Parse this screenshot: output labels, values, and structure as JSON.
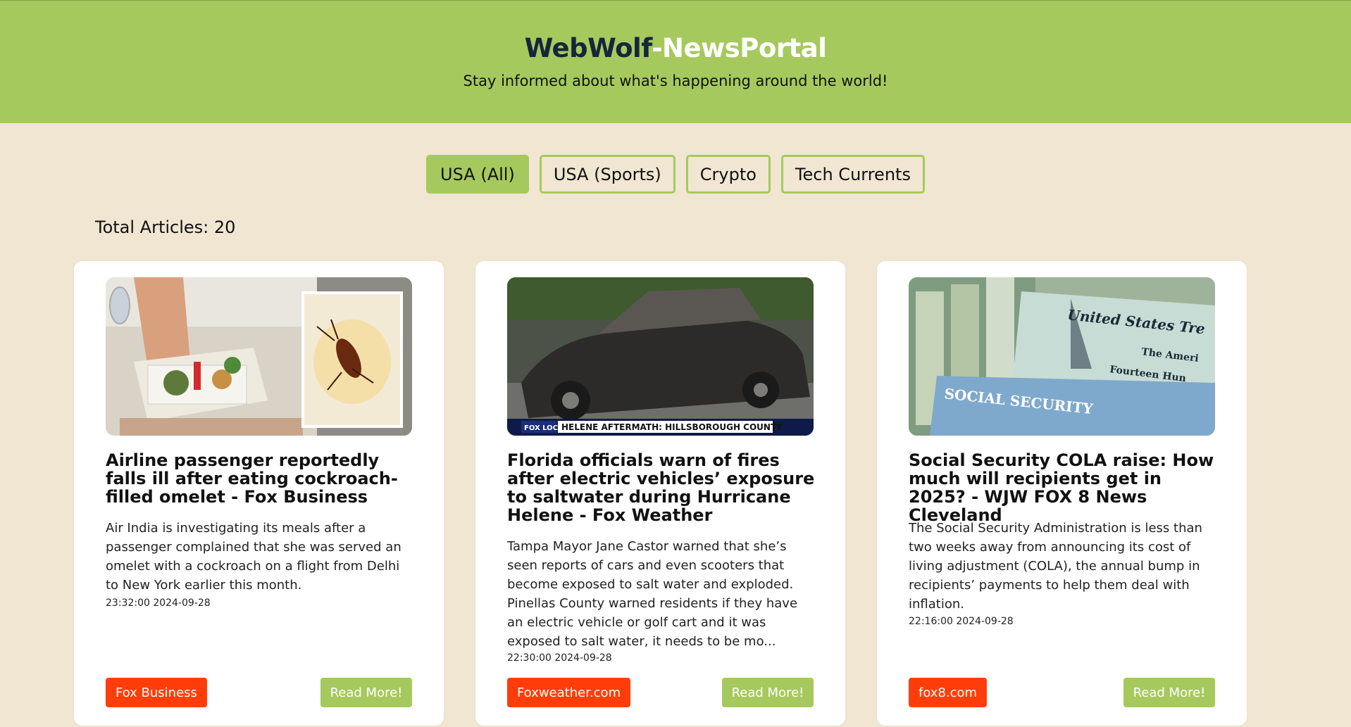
{
  "header": {
    "brand_part1": "WebWolf",
    "brand_part2": "-NewsPortal",
    "tagline": "Stay informed about what's happening around the world!"
  },
  "tabs": [
    {
      "label": "USA (All)",
      "active": true
    },
    {
      "label": "USA (Sports)",
      "active": false
    },
    {
      "label": "Crypto",
      "active": false
    },
    {
      "label": "Tech Currents",
      "active": false
    }
  ],
  "total_articles": "Total Articles: 20",
  "colors": {
    "header_bg": "#a6c95d",
    "page_bg": "#f0e6d2",
    "source_badge": "#ff3d0a",
    "read_more": "#a6c95d",
    "brand_dark": "#14273a"
  },
  "articles": [
    {
      "title": "Airline passenger reportedly falls ill after eating cockroach-filled omelet - Fox Business",
      "description": "Air India is investigating its meals after a passenger complained that she was served an omelet with a cockroach on a flight from Delhi to New York earlier this month.",
      "timestamp": "23:32:00 2024-09-28",
      "source": "Fox Business",
      "read_more": "Read More!"
    },
    {
      "title": "Florida officials warn of fires after electric vehicles’ exposure to saltwater during Hurricane Helene - Fox Weather",
      "description": "Tampa Mayor Jane Castor warned that she’s seen reports of cars and even scooters that become exposed to salt water and exploded. Pinellas County warned residents if they have an electric vehicle or golf cart and it was exposed to salt water, it needs to be mo...",
      "timestamp": "22:30:00 2024-09-28",
      "source": "Foxweather.com",
      "read_more": "Read More!",
      "image_caption": "HELENE AFTERMATH: HILLSBOROUGH COUNTY",
      "image_network": "FOX LOCAL"
    },
    {
      "title": "Social Security COLA raise: How much will recipients get in 2025? - WJW FOX 8 News Cleveland",
      "description": "The Social Security Administration is less than two weeks away from announcing its cost of living adjustment (COLA), the annual bump in recipients’ payments to help them deal with inflation.",
      "timestamp": "22:16:00 2024-09-28",
      "source": "fox8.com",
      "read_more": "Read More!",
      "image_text_1": "United States Tre",
      "image_text_2": "The Ameri",
      "image_text_3": "Fourteen Hun",
      "image_text_4": "SOCIAL SECURITY"
    }
  ]
}
